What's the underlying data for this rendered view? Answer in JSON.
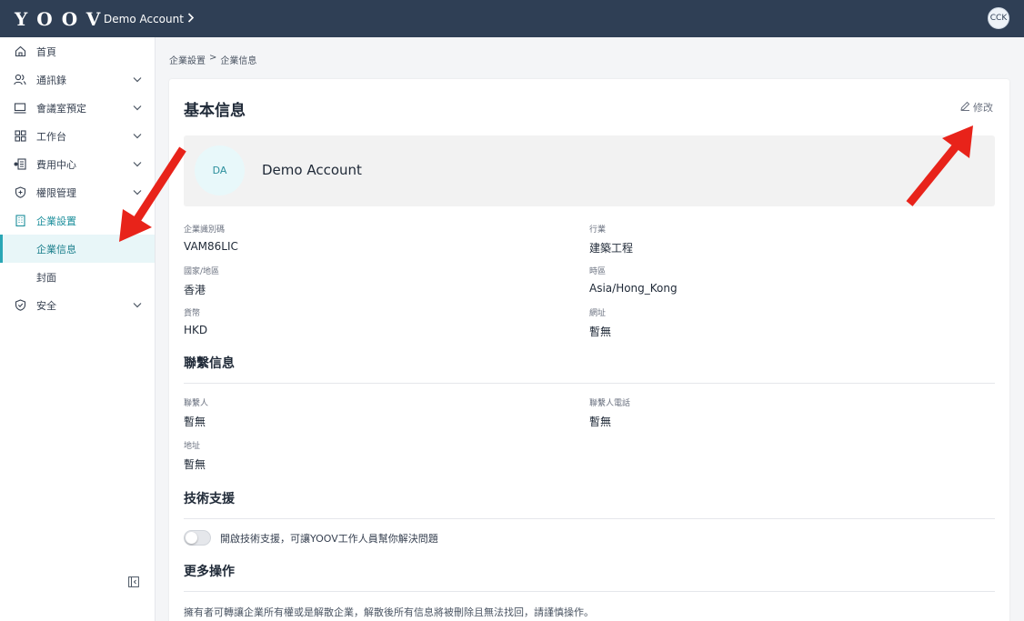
{
  "header": {
    "logo": "YOOV",
    "account": "Demo Account",
    "user_initials": "CCK"
  },
  "sidebar": {
    "items": [
      {
        "label": "首頁",
        "icon": "home-icon"
      },
      {
        "label": "通訊錄",
        "icon": "contacts-icon"
      },
      {
        "label": "會議室預定",
        "icon": "monitor-icon"
      },
      {
        "label": "工作台",
        "icon": "grid-icon"
      },
      {
        "label": "費用中心",
        "icon": "billing-icon"
      },
      {
        "label": "權限管理",
        "icon": "shield-plus-icon"
      },
      {
        "label": "企業設置",
        "icon": "building-icon"
      },
      {
        "label": "企業信息"
      },
      {
        "label": "封面"
      },
      {
        "label": "安全",
        "icon": "shield-check-icon"
      }
    ]
  },
  "breadcrumb": {
    "parent": "企業設置",
    "separator": ">",
    "current": "企業信息"
  },
  "card": {
    "title": "基本信息",
    "edit_label": "修改",
    "avatar_initials": "DA",
    "company_name": "Demo Account",
    "fields": {
      "company_code": {
        "label": "企業識別碼",
        "value": "VAM86LIC"
      },
      "industry": {
        "label": "行業",
        "value": "建築工程"
      },
      "country": {
        "label": "國家/地區",
        "value": "香港"
      },
      "timezone": {
        "label": "時區",
        "value": "Asia/Hong_Kong"
      },
      "currency": {
        "label": "貨幣",
        "value": "HKD"
      },
      "website": {
        "label": "網址",
        "value": "暫無"
      }
    },
    "contact": {
      "title": "聯繫信息",
      "person": {
        "label": "聯繫人",
        "value": "暫無"
      },
      "phone": {
        "label": "聯繫人電話",
        "value": "暫無"
      },
      "address": {
        "label": "地址",
        "value": "暫無"
      }
    },
    "support": {
      "title": "技術支援",
      "toggle_label": "開啟技術支援，可讓YOOV工作人員幫你解決問題",
      "enabled": false
    },
    "more": {
      "title": "更多操作",
      "description": "擁有者可轉讓企業所有權或是解散企業，解散後所有信息將被刪除且無法找回，請謹慎操作。"
    }
  },
  "colors": {
    "topbar": "#2f3f55",
    "accent": "#2aa6b5",
    "annotation_arrow": "#e8231a"
  }
}
